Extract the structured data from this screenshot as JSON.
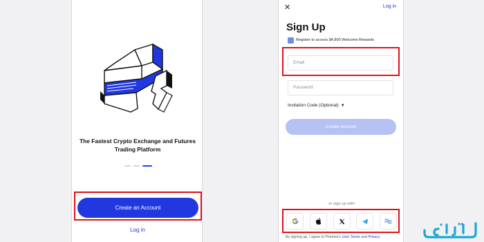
{
  "left_screen": {
    "tagline_line1": "The Fastest Crypto Exchange and Futures",
    "tagline_line2": "Trading Platform",
    "pager": {
      "count": 3,
      "active_index": 2
    },
    "create_account_label": "Create an Account",
    "login_label": "Log in"
  },
  "right_screen": {
    "close_icon": "close-icon",
    "top_login_label": "Log in",
    "title": "Sign Up",
    "promo_text": "Register to access $4,800 Welcome Rewards",
    "email_placeholder": "Email",
    "password_placeholder": "Password",
    "invitation_label": "Invitation Code (Optional)",
    "create_account_label": "Create Account",
    "or_sign_up_with": "or sign up with",
    "social": [
      {
        "name": "google-icon",
        "glyph": "G"
      },
      {
        "name": "apple-icon",
        "glyph": ""
      },
      {
        "name": "x-icon",
        "glyph": "𝕏"
      },
      {
        "name": "telegram-icon",
        "glyph": "➤"
      },
      {
        "name": "wallet-icon",
        "glyph": "∞"
      }
    ],
    "terms_prefix": "By signing up, I agree to Phemex's",
    "terms_link1": "User Terms",
    "terms_and": "and",
    "terms_link2": "Privacy"
  },
  "colors": {
    "highlight": "#e0101a",
    "primary": "#2138e0",
    "primary_disabled": "#b6c1f4",
    "link": "#1f3ad6"
  },
  "watermark_text": "تلماتو"
}
